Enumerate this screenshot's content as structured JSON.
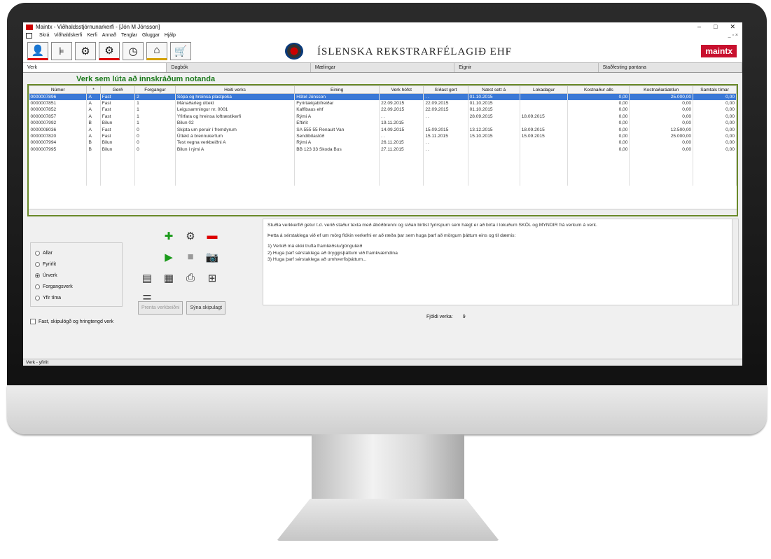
{
  "window": {
    "title": "Maintx - Viðhaldsstjórnunarkerfi - [Jón M Jónsson]",
    "controls": [
      "–",
      "□",
      "✕"
    ]
  },
  "menu": {
    "items": [
      "Skrá",
      "Viðhaldskerfi",
      "Kerfi",
      "Annað",
      "Tenglar",
      "Gluggar",
      "Hjálp"
    ],
    "mdi_controls": "_ ▫ ×"
  },
  "toolbar": {
    "company": "ÍSLENSKA REKSTRARFÉLAGIÐ EHF",
    "brand": "maintx"
  },
  "tabs": [
    "Verk",
    "Dagbók",
    "Mælingar",
    "Eignir",
    "Staðfesting pantana"
  ],
  "heading": "Verk sem lúta að innskráðum notanda",
  "grid": {
    "columns": [
      "Númer",
      "*",
      "Gerð",
      "Forgangur",
      "Heiti verks",
      "Eining",
      "Verk hófst",
      "Síðast gert",
      "Næst sett á",
      "Lokadagur",
      "Kostnaður alls",
      "Kostnaðaráætlun",
      "Samtals tímar"
    ],
    "rows": [
      [
        "0000007896",
        "A",
        "Fast",
        "2",
        "Sópa og hreinsa plastpoka",
        "Hótel Jónsson",
        "",
        ". .",
        "01.10.2015",
        "",
        "0,00",
        "25.000,00",
        "0,00"
      ],
      [
        "0000007851",
        "A",
        "Fast",
        "1",
        "Mánaðarleg úttekt",
        "Fyrirtækjabifreiðar",
        "22.09.2015",
        "22.09.2015",
        "01.10.2015",
        "",
        "0,00",
        "0,00",
        "0,00"
      ],
      [
        "0000007852",
        "A",
        "Fast",
        "1",
        "Leigusamningur nr. 0001",
        "Kaffibaus ehf",
        "22.09.2015",
        "22.09.2015",
        "01.10.2015",
        "",
        "0,00",
        "0,00",
        "0,00"
      ],
      [
        "0000007857",
        "A",
        "Fast",
        "1",
        "Yfirfara og hreinsa loftræstikerfi",
        "Rými A",
        ". .",
        ". .",
        "28.09.2015",
        "18.09.2015",
        "0,00",
        "0,00",
        "0,00"
      ],
      [
        "0000007992",
        "B",
        "Bilun",
        "1",
        "Bilun 02",
        "Eftirlit",
        "19.11.2015",
        "",
        "",
        "",
        "0,00",
        "0,00",
        "0,00"
      ],
      [
        "0000008036",
        "A",
        "Fast",
        "0",
        "Skipta um peruir í fremdyrum",
        "SA 555 55 Renault Van",
        "14.09.2015",
        "15.09.2015",
        "13.12.2015",
        "18.09.2015",
        "0,00",
        "12.500,00",
        "0,00"
      ],
      [
        "0000007820",
        "A",
        "Fast",
        "0",
        "Úttekt á brennukerfum",
        "Sendibílastöð",
        ". .",
        "15.11.2015",
        "15.10.2015",
        "15.09.2015",
        "0,00",
        "25.000,00",
        "0,00"
      ],
      [
        "0000007994",
        "B",
        "Bilun",
        "0",
        "Test vegna verkbeiðni A",
        "Rými A",
        "26.11.2015",
        ". .",
        "",
        "",
        "0,00",
        "0,00",
        "0,00"
      ],
      [
        "0000007995",
        "B",
        "Bilun",
        "0",
        "Bilun í rými A",
        "BB 123 33 Skoda Bus",
        "27.11.2015",
        ". .",
        "",
        "",
        "0,00",
        "0,00",
        "0,00"
      ]
    ]
  },
  "filters": {
    "options": [
      "Allar",
      "Fyrirlit",
      "Úrverk",
      "Forgangsverk",
      "Yfir tíma"
    ],
    "selected": 2
  },
  "buttons": {
    "print_request": "Prenta verkbeiðni",
    "show_details": "Sýna skipulagt"
  },
  "checkbox_label": "Fast, skipulögð og hringtengd verk",
  "info": {
    "p1": "Stuðla verkkerfið getur t.d. verið staður texta með ábóðbrenni og síðan birtist fyrirspurn sem hægt er að birta í lokuðum SKÓL og MYNDIR frá verkum á verk.",
    "p2": "Þetta á sérstaklega við ef um mörg flókin verkefni er að ræða þar sem huga þarf að mörgum þáttum eins og til dæmis:",
    "l1": "1) Verkið má ekki trufla framleiðslu/gönguleið",
    "l2": "2) Huga þarf sérstaklega að öryggisþáttum við framkvæmdina",
    "l3": "3) Huga þarf sérstaklega að umhverfisþáttum..."
  },
  "count": {
    "label": "Fjöldi verka:",
    "value": "9"
  },
  "status": "Verk - yfirlit"
}
